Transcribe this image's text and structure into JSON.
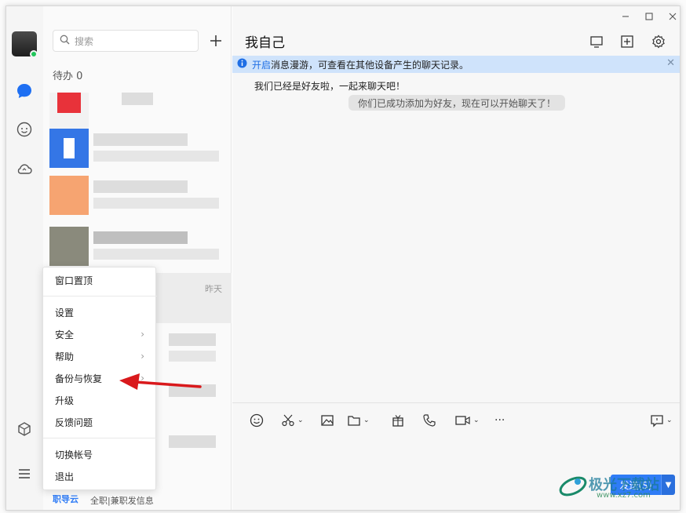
{
  "window": {
    "title": "我自己",
    "controls": [
      "minimize-icon",
      "maximize-icon",
      "close-icon"
    ]
  },
  "sidebar": {
    "icons": [
      "message-icon",
      "contacts-icon",
      "cloud-icon",
      "cube-icon",
      "menu-icon"
    ]
  },
  "search": {
    "placeholder": "搜索"
  },
  "contact_list": {
    "pinned_label": "待办 0",
    "selected_time": "昨天",
    "bottom_brand": "职导云",
    "bottom_text": "全职|兼职发信息"
  },
  "chat": {
    "notice_link": "开启",
    "notice_text": "消息漫游，可查看在其他设备产生的聊天记录。",
    "message": "我们已经是好友啦，一起来聊天吧！",
    "system_message": "你们已成功添加为好友，现在可以开始聊天了！",
    "send_label": "发送(S)"
  },
  "menu": {
    "items": [
      {
        "label": "窗口置顶",
        "submenu": false
      },
      {
        "label": "设置",
        "submenu": false
      },
      {
        "label": "安全",
        "submenu": true
      },
      {
        "label": "帮助",
        "submenu": true
      },
      {
        "label": "备份与恢复",
        "submenu": true
      },
      {
        "label": "升级",
        "submenu": false
      },
      {
        "label": "反馈问题",
        "submenu": false
      },
      {
        "label": "切换帐号",
        "submenu": false
      },
      {
        "label": "退出",
        "submenu": false
      }
    ]
  },
  "watermark": {
    "text": "极光下载站",
    "sub": "www.xz7.com"
  },
  "colors": {
    "accent": "#2f7cf6",
    "notice_bg": "#cfe3fb",
    "online": "#20c55a",
    "annotation_arrow": "#d9191c"
  }
}
